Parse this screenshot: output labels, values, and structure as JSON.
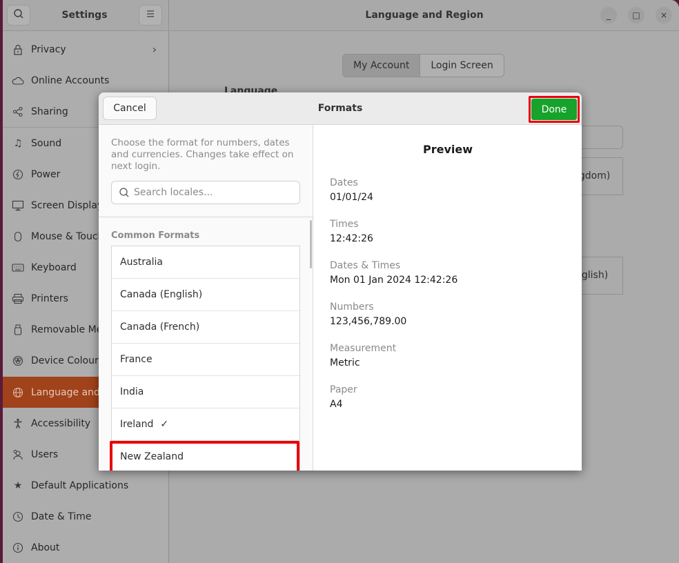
{
  "sidebar": {
    "title": "Settings",
    "search_icon": "search-icon",
    "menu_icon": "hamburger-menu-icon",
    "items": [
      {
        "label": "Privacy",
        "icon": "lock-icon",
        "has_chevron": true
      },
      {
        "label": "Online Accounts",
        "icon": "cloud-icon"
      },
      {
        "label": "Sharing",
        "icon": "share-icon"
      },
      {
        "label": "Sound",
        "icon": "music-note-icon"
      },
      {
        "label": "Power",
        "icon": "power-icon"
      },
      {
        "label": "Screen Display",
        "icon": "display-icon"
      },
      {
        "label": "Mouse & Touchpad",
        "icon": "mouse-icon"
      },
      {
        "label": "Keyboard",
        "icon": "keyboard-icon"
      },
      {
        "label": "Printers",
        "icon": "printer-icon"
      },
      {
        "label": "Removable Media",
        "icon": "usb-drive-icon"
      },
      {
        "label": "Device Colour Profiles",
        "icon": "colour-profile-icon"
      },
      {
        "label": "Language and Region",
        "icon": "globe-icon",
        "active": true
      },
      {
        "label": "Accessibility",
        "icon": "accessibility-icon"
      },
      {
        "label": "Users",
        "icon": "users-icon"
      },
      {
        "label": "Default Applications",
        "icon": "star-icon"
      },
      {
        "label": "Date & Time",
        "icon": "clock-icon"
      },
      {
        "label": "About",
        "icon": "info-icon"
      }
    ]
  },
  "main": {
    "title": "Language and Region",
    "tabs": [
      {
        "label": "My Account",
        "selected": true
      },
      {
        "label": "Login Screen",
        "selected": false
      }
    ],
    "section_label": "Language",
    "partial_row_1": "ngdom)",
    "partial_row_2": "nglish)"
  },
  "window_controls": {
    "minimize": "_",
    "maximize": "□",
    "close": "×"
  },
  "dialog": {
    "title": "Formats",
    "cancel_label": "Cancel",
    "done_label": "Done",
    "description": "Choose the format for numbers, dates and currencies. Changes take effect on next login.",
    "search_placeholder": "Search locales...",
    "search_value": "",
    "section_title": "Common Formats",
    "formats": [
      {
        "label": "Australia"
      },
      {
        "label": "Canada (English)"
      },
      {
        "label": "Canada (French)"
      },
      {
        "label": "France"
      },
      {
        "label": "India"
      },
      {
        "label": "Ireland",
        "selected": true,
        "check": "✓"
      },
      {
        "label": "New Zealand"
      }
    ],
    "preview": {
      "title": "Preview",
      "rows": [
        {
          "label": "Dates",
          "value": "01/01/24"
        },
        {
          "label": "Times",
          "value": "12:42:26"
        },
        {
          "label": "Dates & Times",
          "value": "Mon 01 Jan 2024 12:42:26"
        },
        {
          "label": "Numbers",
          "value": "123,456,789.00"
        },
        {
          "label": "Measurement",
          "value": "Metric"
        },
        {
          "label": "Paper",
          "value": "A4"
        }
      ]
    }
  },
  "colors": {
    "accent_active": "#a0421a",
    "done_button": "#16a22b",
    "highlight_outline": "#e8000a"
  }
}
